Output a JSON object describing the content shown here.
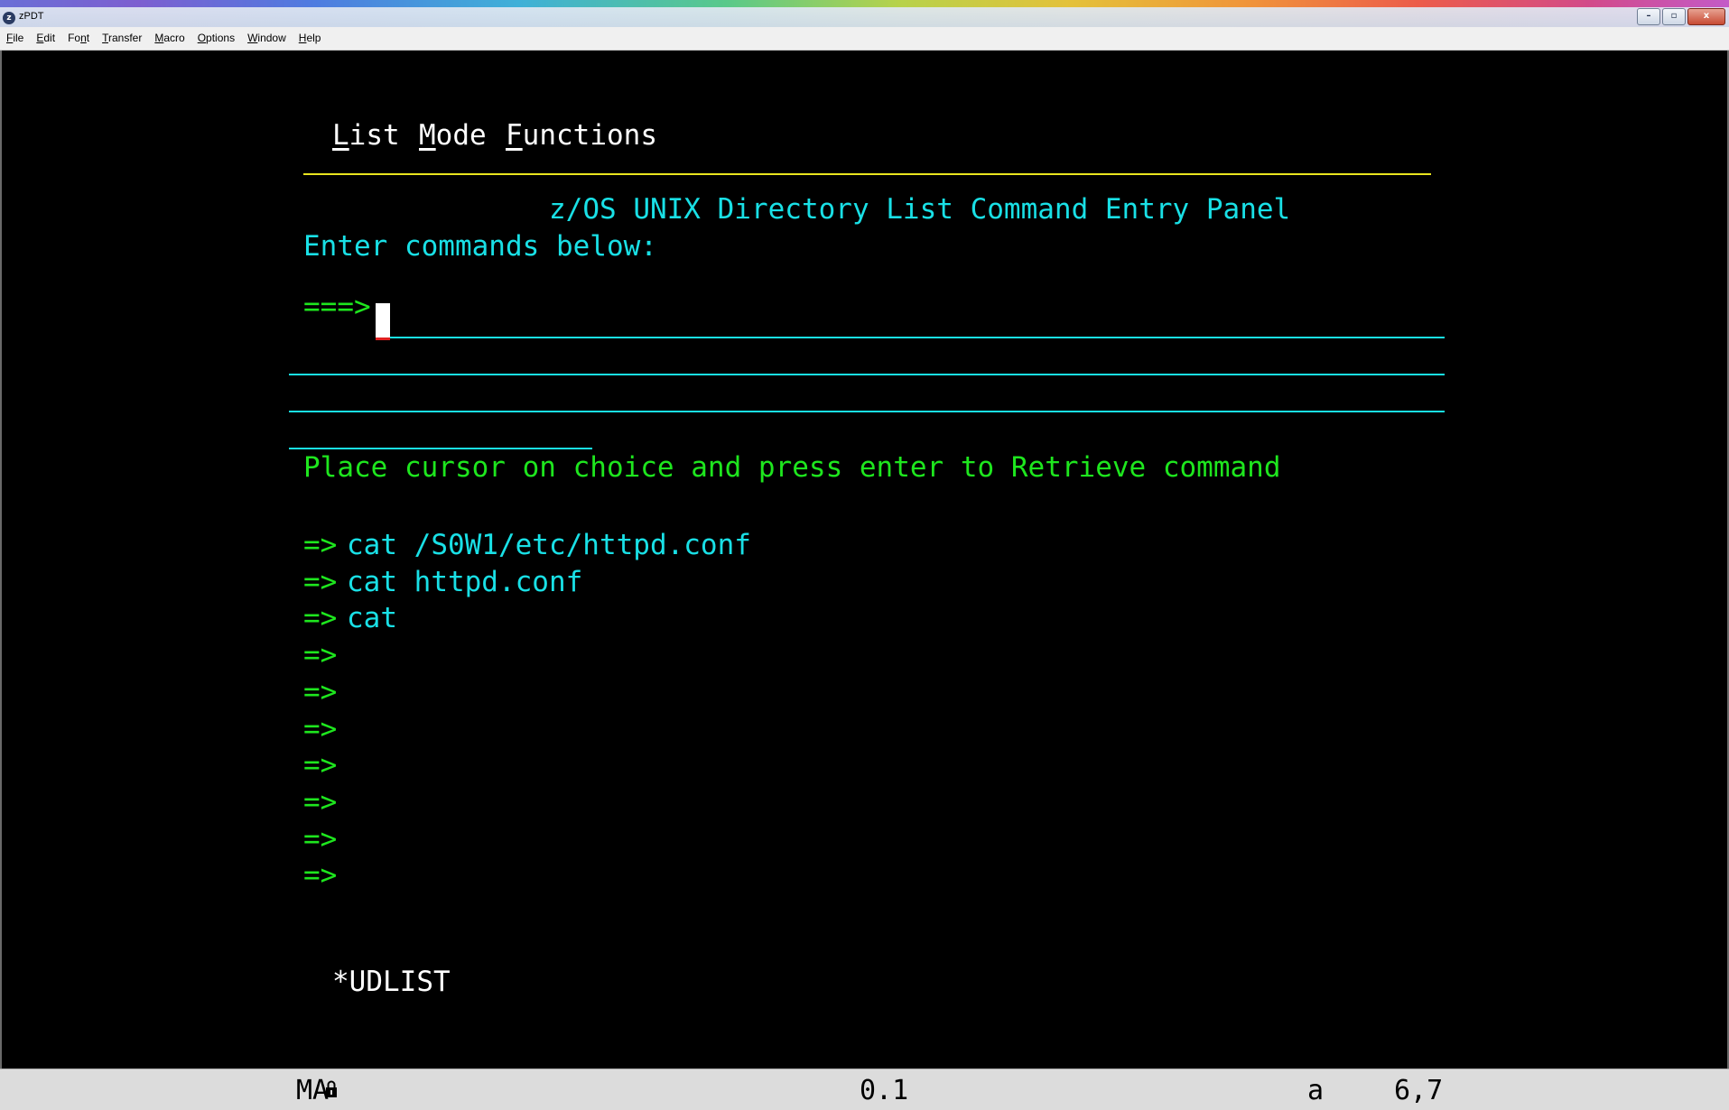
{
  "window": {
    "title": "zPDT",
    "icon": "zpdt-app-icon",
    "controls": {
      "minimize": "–",
      "restore": "▫",
      "close": "x"
    }
  },
  "menubar": [
    {
      "hot": "F",
      "rest": "ile"
    },
    {
      "hot": "E",
      "rest": "dit"
    },
    {
      "pre": "Fo",
      "hot": "n",
      "rest": "t"
    },
    {
      "hot": "T",
      "rest": "ransfer"
    },
    {
      "hot": "M",
      "rest": "acro"
    },
    {
      "hot": "O",
      "rest": "ptions"
    },
    {
      "hot": "W",
      "rest": "indow"
    },
    {
      "hot": "H",
      "rest": "elp"
    }
  ],
  "actionbar": [
    {
      "hot": "L",
      "rest": "ist"
    },
    {
      "hot": "M",
      "rest": "ode"
    },
    {
      "hot": "F",
      "rest": "unctions"
    }
  ],
  "panel": {
    "title": "z/OS UNIX Directory List Command Entry Panel",
    "instruction": "Enter commands below:",
    "prompt": "===>",
    "command_value": "",
    "retrieve_instruction": "Place cursor on choice and press enter to Retrieve command",
    "history_prefix": "=>",
    "history": [
      "cat /S0W1/etc/httpd.conf",
      "cat httpd.conf",
      "cat",
      "",
      "",
      "",
      "",
      "",
      "",
      ""
    ],
    "panel_id": "*UDLIST"
  },
  "statusbar": {
    "mode": "MA",
    "lock_icon": "keyboard-lock-icon",
    "session": "0.1",
    "indicator": "a",
    "cursor_position": "6,7"
  },
  "colors": {
    "background": "#000000",
    "cyan": "#19e0e6",
    "green": "#1ee61e",
    "yellow": "#e9e51f",
    "white": "#ffffff"
  }
}
